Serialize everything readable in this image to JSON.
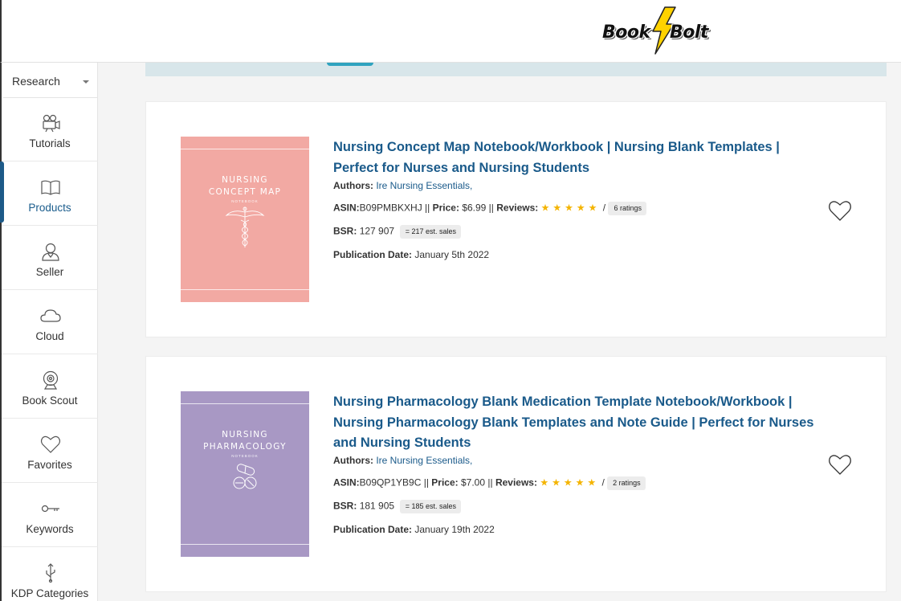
{
  "header": {
    "logo_part1": "Book",
    "logo_part2": "Bolt",
    "accent": "#ffd200"
  },
  "sidebar": {
    "dropdown_value": "Research",
    "items": [
      {
        "label": "Tutorials",
        "icon": "video-camera-icon"
      },
      {
        "label": "Products",
        "icon": "book-open-icon",
        "active": true
      },
      {
        "label": "Seller",
        "icon": "user-icon"
      },
      {
        "label": "Cloud",
        "icon": "cloud-icon"
      },
      {
        "label": "Book Scout",
        "icon": "webcam-icon"
      },
      {
        "label": "Favorites",
        "icon": "heart-icon"
      },
      {
        "label": "Keywords",
        "icon": "key-icon"
      },
      {
        "label": "KDP Categories",
        "icon": "usb-icon"
      }
    ],
    "active_color": "#1d5a88"
  },
  "products": [
    {
      "title": "Nursing Concept Map Notebook/Workbook | Nursing Blank Templates | Perfect for Nurses and Nursing Students",
      "authors_label": "Authors:",
      "authors": "Ire Nursing Essentials,",
      "asin_label": "ASIN:",
      "asin": "B09PMBKXHJ",
      "sep": " || ",
      "price_label": "Price:",
      "price": "$6.99",
      "reviews_label": "Reviews:",
      "stars": "★★★★★",
      "slash": " / ",
      "ratings": "6 ratings",
      "bsr_label": "BSR:",
      "bsr": "127 907",
      "est_sales": "= 217 est. sales",
      "pubdate_label": "Publication Date:",
      "pubdate": "January 5th 2022",
      "cover_line1": "NURSING",
      "cover_line2": "CONCEPT MAP",
      "cover_sub": "NOTEBOOK",
      "cover_color": "#f2a9a3"
    },
    {
      "title": "Nursing Pharmacology Blank Medication Template Notebook/Workbook | Nursing Pharmacology Blank Templates and Note Guide | Perfect for Nurses and Nursing Students",
      "authors_label": "Authors:",
      "authors": "Ire Nursing Essentials,",
      "asin_label": "ASIN:",
      "asin": "B09QP1YB9C",
      "sep": " || ",
      "price_label": "Price:",
      "price": "$7.00",
      "reviews_label": "Reviews:",
      "stars": "★★★★★",
      "slash": " / ",
      "ratings": "2 ratings",
      "bsr_label": "BSR:",
      "bsr": "181 905",
      "est_sales": "= 185 est. sales",
      "pubdate_label": "Publication Date:",
      "pubdate": "January 19th 2022",
      "cover_line1": "NURSING",
      "cover_line2": "PHARMACOLOGY",
      "cover_sub": "NOTEBOOK",
      "cover_color": "#a898c4"
    }
  ]
}
